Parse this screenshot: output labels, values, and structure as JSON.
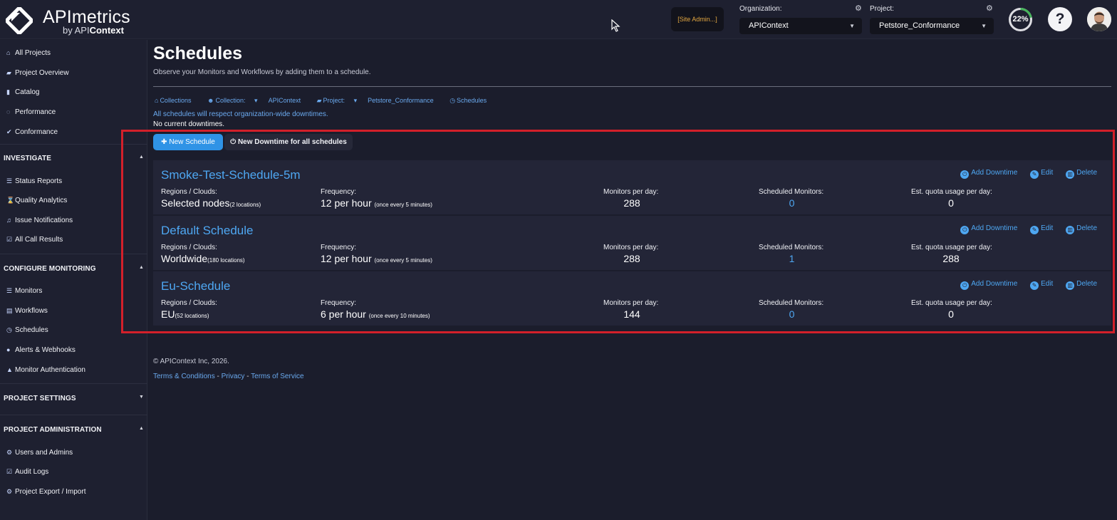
{
  "header": {
    "logo_title": "APImetrics",
    "logo_sub_prefix": "by API",
    "logo_sub_bold": "Context",
    "site_admin": "[Site Admin...]",
    "org_label": "Organization:",
    "org_value": "APIContext",
    "project_label": "Project:",
    "project_value": "Petstore_Conformance",
    "quota_percent": "22%",
    "quota_fraction": 0.22,
    "help": "?"
  },
  "sidebar": {
    "top_items": [
      {
        "label": "All Projects",
        "icon": "home-icon"
      },
      {
        "label": "Project Overview",
        "icon": "folder-open-icon"
      },
      {
        "label": "Catalog",
        "icon": "book-icon"
      },
      {
        "label": "Performance",
        "icon": "gauge-icon"
      },
      {
        "label": "Conformance",
        "icon": "check-icon"
      }
    ],
    "investigate": {
      "title": "INVESTIGATE",
      "items": [
        {
          "label": "Status Reports",
          "icon": "list-icon"
        },
        {
          "label": "Quality Analytics",
          "icon": "hourglass-icon"
        },
        {
          "label": "Issue Notifications",
          "icon": "bell-icon"
        },
        {
          "label": "All Call Results",
          "icon": "check-square-icon"
        }
      ]
    },
    "configure": {
      "title": "CONFIGURE MONITORING",
      "items": [
        {
          "label": "Monitors",
          "icon": "list-icon"
        },
        {
          "label": "Workflows",
          "icon": "workflow-icon"
        },
        {
          "label": "Schedules",
          "icon": "clock-icon"
        },
        {
          "label": "Alerts & Webhooks",
          "icon": "globe-icon"
        },
        {
          "label": "Monitor Authentication",
          "icon": "lock-icon"
        }
      ]
    },
    "settings": {
      "title": "PROJECT SETTINGS"
    },
    "admin": {
      "title": "PROJECT ADMINISTRATION",
      "items": [
        {
          "label": "Users and Admins",
          "icon": "gear-icon"
        },
        {
          "label": "Audit Logs",
          "icon": "check-square-icon"
        },
        {
          "label": "Project Export / Import",
          "icon": "gear-icon"
        }
      ]
    }
  },
  "main": {
    "title": "Schedules",
    "description": "Observe your Monitors and Workflows by adding them to a schedule.",
    "breadcrumb": {
      "collections": "Collections",
      "collection_label": "Collection:",
      "collection_value": "APIContext",
      "project_label": "Project:",
      "project_value": "Petstore_Conformance",
      "schedules": "Schedules"
    },
    "notice": "All schedules will respect organization-wide downtimes.",
    "no_downtimes": "No current downtimes.",
    "new_schedule": "New Schedule",
    "new_downtime": "New Downtime for all schedules",
    "labels": {
      "regions": "Regions / Clouds:",
      "frequency": "Frequency:",
      "monitors_per_day": "Monitors per day:",
      "scheduled_monitors": "Scheduled Monitors:",
      "quota": "Est. quota usage per day:",
      "add_downtime": "Add Downtime",
      "edit": "Edit",
      "delete": "Delete"
    },
    "schedules": [
      {
        "name": "Smoke-Test-Schedule-5m",
        "region": "Selected nodes",
        "region_note": "(2 locations)",
        "frequency": "12 per hour",
        "frequency_note": "(once every 5 minutes)",
        "monitors_per_day": "288",
        "scheduled_monitors": "0",
        "quota": "0"
      },
      {
        "name": "Default Schedule",
        "region": "Worldwide",
        "region_note": "(180 locations)",
        "frequency": "12 per hour",
        "frequency_note": "(once every 5 minutes)",
        "monitors_per_day": "288",
        "scheduled_monitors": "1",
        "quota": "288"
      },
      {
        "name": "Eu-Schedule",
        "region": "EU",
        "region_note": "(52 locations)",
        "frequency": "6 per hour",
        "frequency_note": "(once every 10 minutes)",
        "monitors_per_day": "144",
        "scheduled_monitors": "0",
        "quota": "0"
      }
    ]
  },
  "footer": {
    "copyright": "© APIContext Inc, 2026.",
    "terms": "Terms & Conditions",
    "sep": "-",
    "privacy": "Privacy",
    "service": "Terms of Service"
  },
  "colors": {
    "accent": "#4ea7f2",
    "primary_button": "#2f93e6",
    "highlight": "#d3202a",
    "site_admin": "#e2a640"
  }
}
